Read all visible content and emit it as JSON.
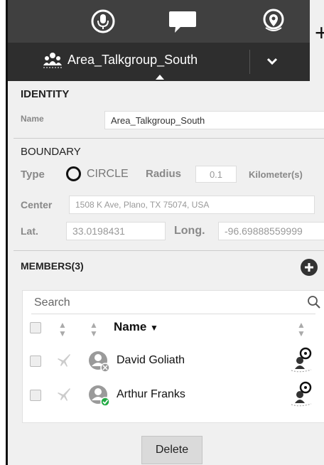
{
  "header": {
    "talkgroup_name": "Area_Talkgroup_South",
    "icons": [
      "microphone-icon",
      "chat-bubble-icon",
      "location-pin-icon",
      "chevron-down-icon"
    ]
  },
  "side_plus": "+",
  "identity": {
    "heading": "IDENTITY",
    "name_label": "Name",
    "name_value": "Area_Talkgroup_South"
  },
  "boundary": {
    "heading": "BOUNDARY",
    "type_label": "Type",
    "type_value": "CIRCLE",
    "radius_label": "Radius",
    "radius_value": "0.1",
    "radius_unit": "Kilometer(s)",
    "center_label": "Center",
    "center_value": "1508 K Ave, Plano, TX 75074, USA",
    "lat_label": "Lat.",
    "lat_value": "33.0198431",
    "long_label": "Long.",
    "long_value": "-96.69888559999"
  },
  "members": {
    "heading": "MEMBERS(3)",
    "search_placeholder": "Search",
    "name_column": "Name",
    "rows": [
      {
        "name": "David Goliath",
        "status": "offline"
      },
      {
        "name": "Arthur Franks",
        "status": "online"
      }
    ]
  },
  "delete_label": "Delete",
  "colors": {
    "header_bg": "#404040",
    "subheader_bg": "#2e2e2e",
    "online": "#22aa44"
  }
}
